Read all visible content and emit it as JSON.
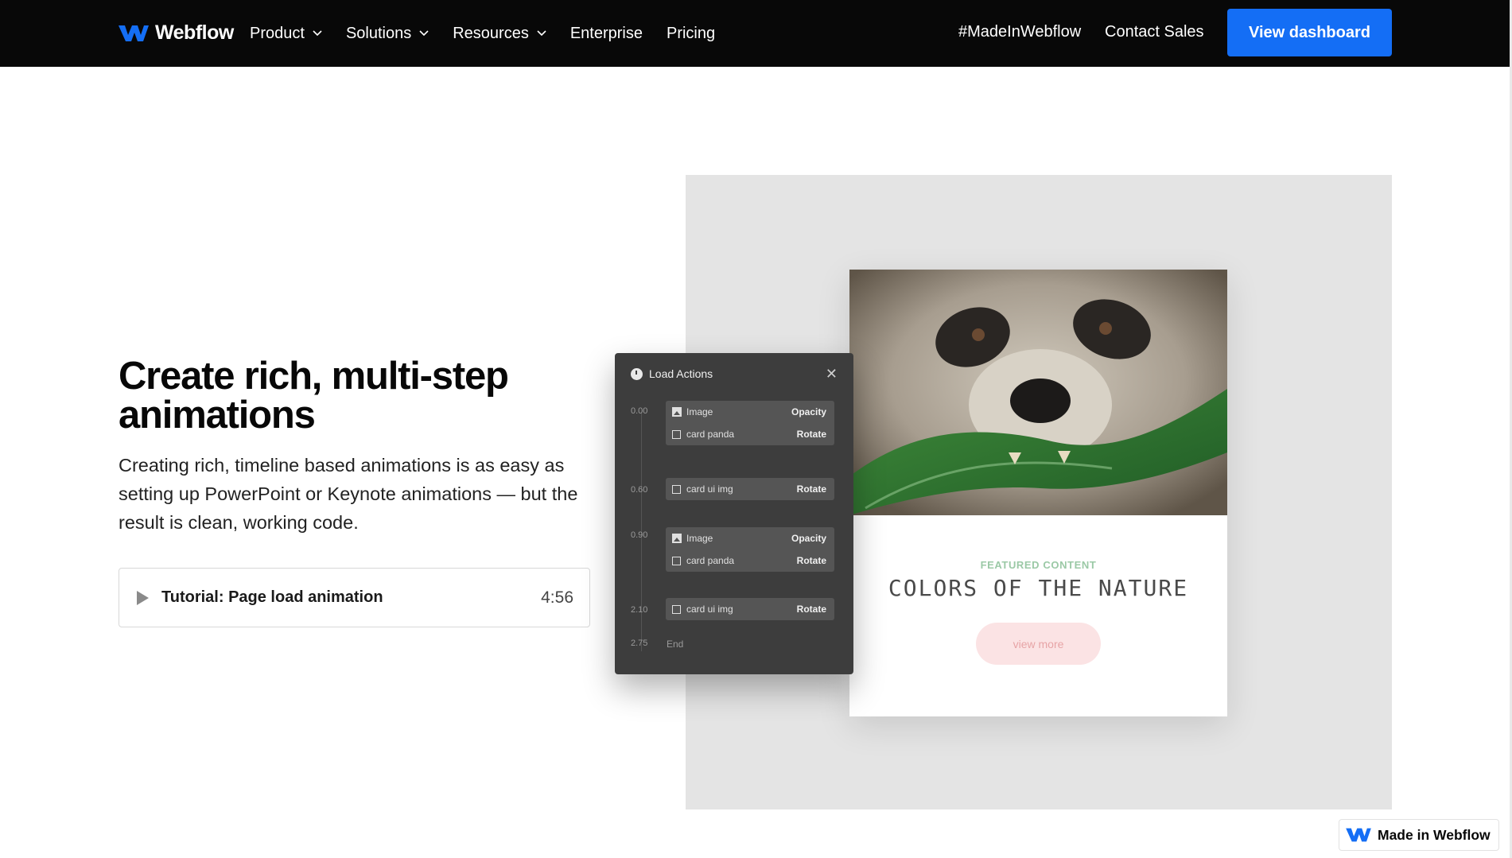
{
  "nav": {
    "logo_text": "Webflow",
    "items": [
      {
        "label": "Product",
        "has_dropdown": true
      },
      {
        "label": "Solutions",
        "has_dropdown": true
      },
      {
        "label": "Resources",
        "has_dropdown": true
      },
      {
        "label": "Enterprise",
        "has_dropdown": false
      },
      {
        "label": "Pricing",
        "has_dropdown": false
      }
    ],
    "right": {
      "made_in": "#MadeInWebflow",
      "contact": "Contact Sales",
      "cta": "View dashboard"
    }
  },
  "hero": {
    "headline": "Create rich, multi-step animations",
    "body": "Creating rich, timeline based animations is as easy as setting up PowerPoint or Keynote animations — but the result is clean, working code.",
    "tutorial": {
      "label": "Tutorial: Page load animation",
      "duration": "4:56"
    }
  },
  "card": {
    "eyebrow": "FEATURED CONTENT",
    "title": "COLORS OF THE NATURE",
    "button": "view more"
  },
  "load_actions": {
    "title": "Load Actions",
    "steps": [
      {
        "time": "0.00",
        "rows": [
          {
            "icon": "image-icon",
            "name": "Image",
            "action": "Opacity"
          },
          {
            "icon": "checkbox-icon",
            "name": "card panda",
            "action": "Rotate"
          }
        ]
      },
      {
        "time": "0.60",
        "rows": [
          {
            "icon": "checkbox-icon",
            "name": "card ui img",
            "action": "Rotate"
          }
        ]
      },
      {
        "time": "0.90",
        "rows": [
          {
            "icon": "image-icon",
            "name": "Image",
            "action": "Opacity"
          },
          {
            "icon": "checkbox-icon",
            "name": "card panda",
            "action": "Rotate"
          }
        ]
      },
      {
        "time": "2.10",
        "rows": [
          {
            "icon": "checkbox-icon",
            "name": "card ui img",
            "action": "Rotate"
          }
        ]
      }
    ],
    "end_time": "2.75",
    "end_label": "End"
  },
  "badge": {
    "label": "Made in Webflow"
  },
  "colors": {
    "nav_bg": "#080808",
    "accent": "#146ef5",
    "panel_bg": "#3d3d3d",
    "gray_panel": "#e4e4e4",
    "eyebrow": "#9bc9a6",
    "pink_button": "#fbe3e4"
  }
}
